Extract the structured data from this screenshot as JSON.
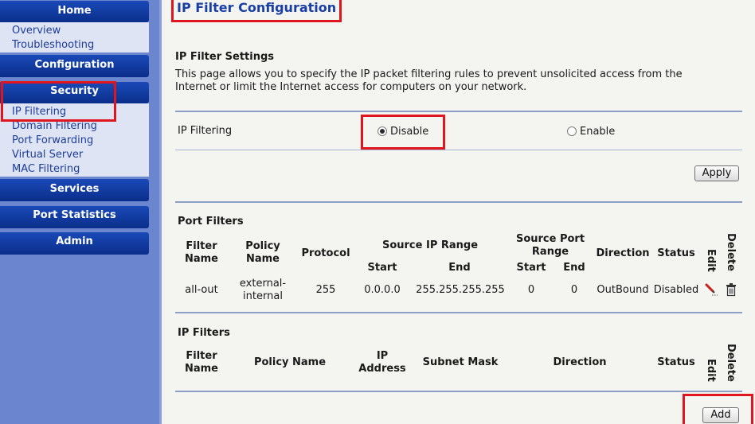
{
  "sidebar": {
    "home": "Home",
    "home_items": [
      "Overview",
      "Troubleshooting"
    ],
    "configuration": "Configuration",
    "security": "Security",
    "security_items": [
      "IP Filtering",
      "Domain Filtering",
      "Port Forwarding",
      "Virtual Server",
      "MAC Filtering"
    ],
    "services": "Services",
    "port_statistics": "Port Statistics",
    "admin": "Admin"
  },
  "page": {
    "title": "IP Filter Configuration",
    "settings_heading": "IP Filter Settings",
    "description_line1": "This page allows you to specify the IP packet filtering rules to prevent unsolicited access from the",
    "description_line2": "Internet or limit the Internet access for computers on your network."
  },
  "ip_filtering": {
    "label": "IP Filtering",
    "options": [
      "Disable",
      "Enable"
    ],
    "selected": "Disable",
    "apply_label": "Apply"
  },
  "port_filters": {
    "heading": "Port Filters",
    "headers": {
      "filter_name": [
        "Filter",
        "Name"
      ],
      "policy_name": [
        "Policy",
        "Name"
      ],
      "protocol": "Protocol",
      "source_ip_range": "Source IP Range",
      "source_port_range": [
        "Source Port",
        "Range"
      ],
      "start": "Start",
      "end": "End",
      "port_start": "Start",
      "port_end": "End",
      "direction": "Direction",
      "status": "Status",
      "edit": "Edit",
      "delete": "Delete"
    },
    "rows": [
      {
        "filter_name": "all-out",
        "policy_name": [
          "external-",
          "internal"
        ],
        "protocol": "255",
        "ip_start": "0.0.0.0",
        "ip_end": "255.255.255.255",
        "port_start": "0",
        "port_end": "0",
        "direction": "OutBound",
        "status": "Disabled"
      }
    ]
  },
  "ip_filters": {
    "heading": "IP Filters",
    "headers": {
      "filter_name": [
        "Filter",
        "Name"
      ],
      "policy_name": "Policy Name",
      "ip_address": [
        "IP",
        "Address"
      ],
      "subnet_mask": "Subnet Mask",
      "direction": "Direction",
      "status": "Status",
      "edit": "Edit",
      "delete": "Delete"
    },
    "add_label": "Add"
  },
  "colors": {
    "sidebar_bg": "#6b86cf",
    "nav_header": "#0a2e8a",
    "link": "#1c3d98",
    "title": "#1a3fa6",
    "highlight": "#e0161e"
  },
  "icons": [
    "pencil-edit-icon",
    "trash-delete-icon"
  ]
}
